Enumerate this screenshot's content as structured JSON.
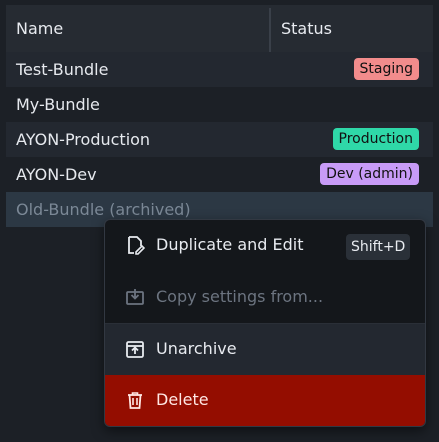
{
  "table": {
    "headers": {
      "name": "Name",
      "status": "Status"
    },
    "rows": [
      {
        "name": "Test-Bundle",
        "status": "Staging",
        "status_color": "#f28c8c"
      },
      {
        "name": "My-Bundle",
        "status": "",
        "status_color": ""
      },
      {
        "name": "AYON-Production",
        "status": "Production",
        "status_color": "#2fd8a8"
      },
      {
        "name": "AYON-Dev",
        "status": "Dev (admin)",
        "status_color": "#c89bf7"
      },
      {
        "name": "Old-Bundle (archived)",
        "status": "",
        "status_color": ""
      }
    ]
  },
  "context_menu": {
    "items": [
      {
        "label": "Duplicate and Edit",
        "shortcut": "Shift+D",
        "icon": "edit-document-icon",
        "enabled": true
      },
      {
        "label": "Copy settings from...",
        "shortcut": "",
        "icon": "download-box-icon",
        "enabled": false
      },
      {
        "label": "Unarchive",
        "shortcut": "",
        "icon": "unarchive-icon",
        "enabled": true
      },
      {
        "label": "Delete",
        "shortcut": "",
        "icon": "trash-icon",
        "enabled": true,
        "danger": true
      }
    ]
  },
  "colors": {
    "background": "#1c2026",
    "delete_bg": "#940d00",
    "selected_row": "#2c3844"
  }
}
